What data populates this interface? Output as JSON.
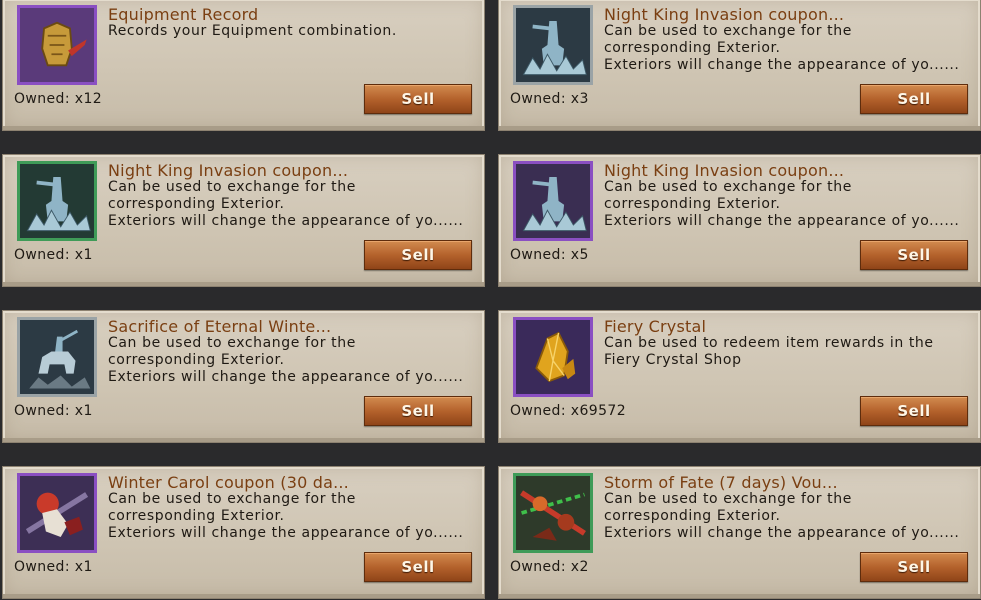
{
  "sell_label": "Sell",
  "items": [
    {
      "name": "Equipment Record",
      "desc": [
        "Records your Equipment combination."
      ],
      "owned": "Owned: x12",
      "icon": "armor-icon",
      "frame": "purple"
    },
    {
      "name": "Night King Invasion coupon...",
      "desc": [
        "Can be used to exchange for the",
        "corresponding Exterior.",
        "Exteriors will change the appearance of yo......"
      ],
      "owned": "Owned: x3",
      "icon": "night-king-statue-icon",
      "frame": "silver"
    },
    {
      "name": "Night King Invasion coupon...",
      "desc": [
        "Can be used to exchange for the",
        "corresponding Exterior.",
        "Exteriors will change the appearance of yo......"
      ],
      "owned": "Owned: x1",
      "icon": "night-king-statue-icon",
      "frame": "green"
    },
    {
      "name": "Night King Invasion coupon...",
      "desc": [
        "Can be used to exchange for the",
        "corresponding Exterior.",
        "Exteriors will change the appearance of yo......"
      ],
      "owned": "Owned: x5",
      "icon": "night-king-statue-icon",
      "frame": "purple"
    },
    {
      "name": "Sacrifice of Eternal Winte...",
      "desc": [
        "Can be used to exchange for the",
        "corresponding Exterior.",
        "Exteriors will change the appearance of yo......"
      ],
      "owned": "Owned: x1",
      "icon": "horse-rider-statue-icon",
      "frame": "silver"
    },
    {
      "name": "Fiery Crystal",
      "desc": [
        "Can be used to redeem item rewards in the",
        "Fiery Crystal Shop"
      ],
      "owned": "Owned: x69572",
      "icon": "crystal-icon",
      "frame": "purple"
    },
    {
      "name": "Winter Carol coupon (30 da...",
      "desc": [
        "Can be used to exchange for the",
        "corresponding Exterior.",
        "Exteriors will change the appearance of yo......"
      ],
      "owned": "Owned: x1",
      "icon": "winter-carol-icon",
      "frame": "purple"
    },
    {
      "name": "Storm of Fate (7 days) Vou...",
      "desc": [
        "Can be used to exchange for the",
        "corresponding Exterior.",
        "Exteriors will change the appearance of yo......"
      ],
      "owned": "Owned: x2",
      "icon": "storm-of-fate-icon",
      "frame": "green"
    }
  ]
}
